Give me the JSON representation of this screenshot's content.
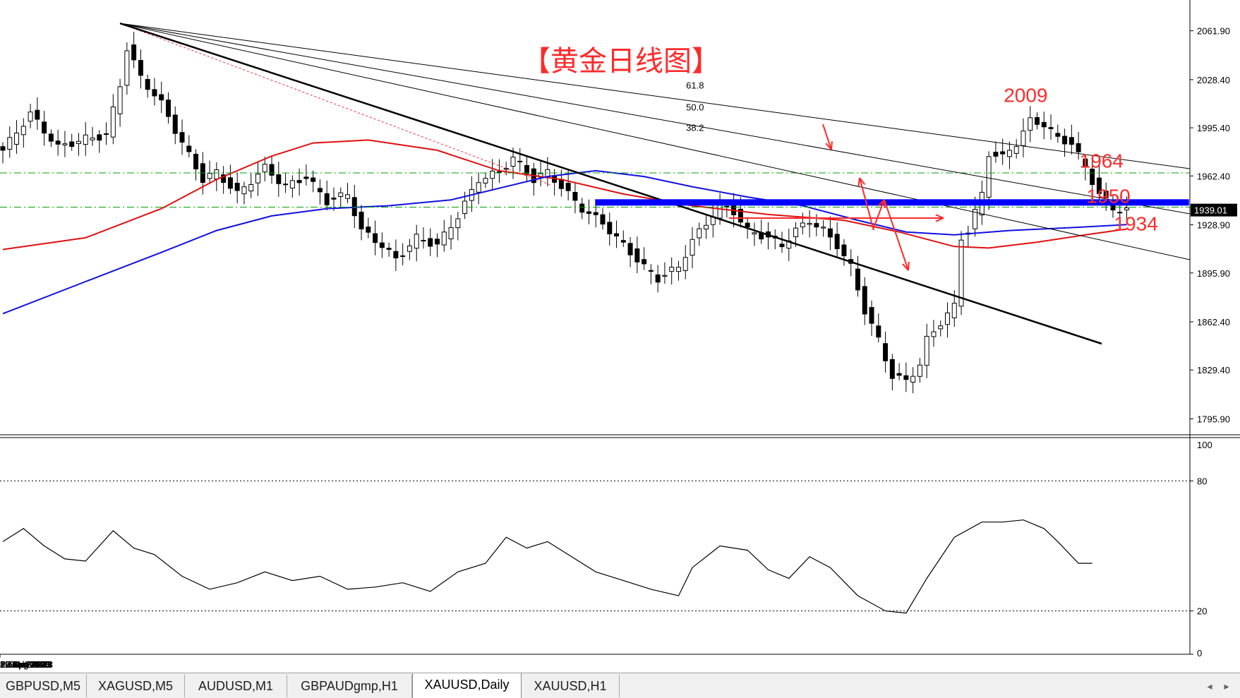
{
  "colors": {
    "background": "#ffffff",
    "candle": "#000000",
    "ma_fast": "#e01010",
    "ma_slow": "#1010e0",
    "annotation": "#ff2a2a",
    "support_band": "#0000ff",
    "ref_line": "#00a000"
  },
  "chart_data": [
    {
      "type": "candlestick",
      "symbol": "XAUUSD",
      "timeframe": "Daily",
      "title": "【黄金日线图】",
      "x_labels": [
        {
          "index": 0,
          "label": "23"
        },
        {
          "index": 15,
          "label": "20 Apr 2023"
        },
        {
          "index": 31,
          "label": "12 May 2023"
        },
        {
          "index": 47,
          "label": "5 Jun 2023"
        },
        {
          "index": 63,
          "label": "27 Jun 2023"
        },
        {
          "index": 79,
          "label": "19 Jul 2023"
        },
        {
          "index": 95,
          "label": "10 Aug 2023"
        },
        {
          "index": 111,
          "label": "1 Sep 2023"
        },
        {
          "index": 127,
          "label": "25 Sep 2023"
        },
        {
          "index": 143,
          "label": "17 Oct 2023"
        },
        {
          "index": 159,
          "label": "8 Nov 2023"
        }
      ],
      "y_ticks": [
        "2061.90",
        "2028.40",
        "1995.40",
        "1962.40",
        "1928.90",
        "1895.90",
        "1862.40",
        "1829.40",
        "1795.90"
      ],
      "y_range": [
        1785.0,
        2083.0
      ],
      "current_price": "1939.01",
      "candle_series": [
        {
          "i": 0,
          "close": 1980
        },
        {
          "i": 4,
          "close": 2005
        },
        {
          "i": 8,
          "close": 1982
        },
        {
          "i": 12,
          "close": 1988
        },
        {
          "i": 15,
          "close": 1990
        },
        {
          "i": 17,
          "close": 2025
        },
        {
          "i": 18,
          "close": 2050
        },
        {
          "i": 20,
          "close": 2030
        },
        {
          "i": 23,
          "close": 2012
        },
        {
          "i": 26,
          "close": 1985
        },
        {
          "i": 29,
          "close": 1960
        },
        {
          "i": 31,
          "close": 1965
        },
        {
          "i": 34,
          "close": 1950
        },
        {
          "i": 38,
          "close": 1968
        },
        {
          "i": 41,
          "close": 1955
        },
        {
          "i": 44,
          "close": 1962
        },
        {
          "i": 47,
          "close": 1945
        },
        {
          "i": 50,
          "close": 1950
        },
        {
          "i": 52,
          "close": 1925
        },
        {
          "i": 55,
          "close": 1915
        },
        {
          "i": 57,
          "close": 1905
        },
        {
          "i": 60,
          "close": 1920
        },
        {
          "i": 63,
          "close": 1915
        },
        {
          "i": 66,
          "close": 1935
        },
        {
          "i": 69,
          "close": 1960
        },
        {
          "i": 72,
          "close": 1965
        },
        {
          "i": 74,
          "close": 1975
        },
        {
          "i": 77,
          "close": 1960
        },
        {
          "i": 79,
          "close": 1965
        },
        {
          "i": 81,
          "close": 1955
        },
        {
          "i": 84,
          "close": 1940
        },
        {
          "i": 87,
          "close": 1930
        },
        {
          "i": 90,
          "close": 1915
        },
        {
          "i": 93,
          "close": 1900
        },
        {
          "i": 95,
          "close": 1892
        },
        {
          "i": 98,
          "close": 1900
        },
        {
          "i": 100,
          "close": 1918
        },
        {
          "i": 102,
          "close": 1930
        },
        {
          "i": 104,
          "close": 1942
        },
        {
          "i": 106,
          "close": 1938
        },
        {
          "i": 108,
          "close": 1925
        },
        {
          "i": 111,
          "close": 1920
        },
        {
          "i": 113,
          "close": 1915
        },
        {
          "i": 115,
          "close": 1925
        },
        {
          "i": 117,
          "close": 1932
        },
        {
          "i": 119,
          "close": 1925
        },
        {
          "i": 121,
          "close": 1915
        },
        {
          "i": 123,
          "close": 1900
        },
        {
          "i": 125,
          "close": 1870
        },
        {
          "i": 127,
          "close": 1850
        },
        {
          "i": 129,
          "close": 1825
        },
        {
          "i": 131,
          "close": 1822
        },
        {
          "i": 133,
          "close": 1833
        },
        {
          "i": 134,
          "close": 1850
        },
        {
          "i": 136,
          "close": 1862
        },
        {
          "i": 138,
          "close": 1873
        },
        {
          "i": 139,
          "close": 1920
        },
        {
          "i": 140,
          "close": 1925
        },
        {
          "i": 142,
          "close": 1950
        },
        {
          "i": 143,
          "close": 1978
        },
        {
          "i": 145,
          "close": 1975
        },
        {
          "i": 147,
          "close": 1985
        },
        {
          "i": 149,
          "close": 2000
        },
        {
          "i": 151,
          "close": 1998
        },
        {
          "i": 153,
          "close": 1988
        },
        {
          "i": 155,
          "close": 1985
        },
        {
          "i": 157,
          "close": 1968
        },
        {
          "i": 159,
          "close": 1950
        },
        {
          "i": 161,
          "close": 1940
        },
        {
          "i": 163,
          "close": 1939
        }
      ],
      "ma_fast": [
        {
          "i": 0,
          "v": 1912
        },
        {
          "i": 12,
          "v": 1920
        },
        {
          "i": 23,
          "v": 1940
        },
        {
          "i": 31,
          "v": 1960
        },
        {
          "i": 39,
          "v": 1976
        },
        {
          "i": 45,
          "v": 1985
        },
        {
          "i": 53,
          "v": 1987
        },
        {
          "i": 63,
          "v": 1980
        },
        {
          "i": 72,
          "v": 1966
        },
        {
          "i": 81,
          "v": 1960
        },
        {
          "i": 90,
          "v": 1950
        },
        {
          "i": 100,
          "v": 1942
        },
        {
          "i": 111,
          "v": 1936
        },
        {
          "i": 122,
          "v": 1932
        },
        {
          "i": 130,
          "v": 1924
        },
        {
          "i": 138,
          "v": 1914
        },
        {
          "i": 143,
          "v": 1913
        },
        {
          "i": 150,
          "v": 1917
        },
        {
          "i": 157,
          "v": 1922
        },
        {
          "i": 163,
          "v": 1926
        }
      ],
      "ma_slow": [
        {
          "i": 0,
          "v": 1868
        },
        {
          "i": 12,
          "v": 1890
        },
        {
          "i": 23,
          "v": 1910
        },
        {
          "i": 31,
          "v": 1925
        },
        {
          "i": 39,
          "v": 1935
        },
        {
          "i": 47,
          "v": 1940
        },
        {
          "i": 56,
          "v": 1942
        },
        {
          "i": 65,
          "v": 1946
        },
        {
          "i": 72,
          "v": 1954
        },
        {
          "i": 79,
          "v": 1962
        },
        {
          "i": 86,
          "v": 1966
        },
        {
          "i": 93,
          "v": 1962
        },
        {
          "i": 100,
          "v": 1955
        },
        {
          "i": 108,
          "v": 1948
        },
        {
          "i": 116,
          "v": 1942
        },
        {
          "i": 124,
          "v": 1932
        },
        {
          "i": 131,
          "v": 1924
        },
        {
          "i": 138,
          "v": 1922
        },
        {
          "i": 146,
          "v": 1925
        },
        {
          "i": 155,
          "v": 1927
        },
        {
          "i": 163,
          "v": 1929
        }
      ],
      "fib_fan": {
        "origin": {
          "i": 17,
          "v": 2067
        },
        "labels": [
          {
            "text": "61.8",
            "i": 95,
            "v": 2029
          },
          {
            "text": "50.0",
            "i": 95,
            "v": 2014
          },
          {
            "text": "38.2",
            "i": 95,
            "v": 2000
          }
        ]
      },
      "annotations": [
        {
          "text": "2009",
          "i": 147,
          "v": 2013
        },
        {
          "text": "1964",
          "i": 158,
          "v": 1968
        },
        {
          "text": "1950",
          "i": 159,
          "v": 1944
        },
        {
          "text": "1934",
          "i": 163,
          "v": 1925
        }
      ],
      "support_band": {
        "from_i": 90,
        "to_i": 171,
        "v": 1944
      },
      "ref_lines": [
        1964.5,
        1941
      ]
    },
    {
      "type": "line",
      "series_label": "",
      "y_ticks": [
        "100",
        "80",
        "20",
        "0"
      ],
      "y_range": [
        0,
        100
      ],
      "levels": [
        80,
        20
      ],
      "values": [
        {
          "i": 0,
          "v": 52
        },
        {
          "i": 3,
          "v": 58
        },
        {
          "i": 6,
          "v": 50
        },
        {
          "i": 9,
          "v": 44
        },
        {
          "i": 12,
          "v": 43
        },
        {
          "i": 16,
          "v": 57
        },
        {
          "i": 19,
          "v": 49
        },
        {
          "i": 22,
          "v": 46
        },
        {
          "i": 26,
          "v": 36
        },
        {
          "i": 30,
          "v": 30
        },
        {
          "i": 34,
          "v": 33
        },
        {
          "i": 38,
          "v": 38
        },
        {
          "i": 42,
          "v": 34
        },
        {
          "i": 46,
          "v": 36
        },
        {
          "i": 50,
          "v": 30
        },
        {
          "i": 54,
          "v": 31
        },
        {
          "i": 58,
          "v": 33
        },
        {
          "i": 62,
          "v": 29
        },
        {
          "i": 66,
          "v": 38
        },
        {
          "i": 70,
          "v": 42
        },
        {
          "i": 73,
          "v": 54
        },
        {
          "i": 76,
          "v": 49
        },
        {
          "i": 79,
          "v": 52
        },
        {
          "i": 82,
          "v": 46
        },
        {
          "i": 86,
          "v": 38
        },
        {
          "i": 90,
          "v": 34
        },
        {
          "i": 94,
          "v": 30
        },
        {
          "i": 98,
          "v": 27
        },
        {
          "i": 100,
          "v": 40
        },
        {
          "i": 104,
          "v": 50
        },
        {
          "i": 108,
          "v": 48
        },
        {
          "i": 111,
          "v": 39
        },
        {
          "i": 114,
          "v": 35
        },
        {
          "i": 117,
          "v": 45
        },
        {
          "i": 120,
          "v": 40
        },
        {
          "i": 124,
          "v": 27
        },
        {
          "i": 128,
          "v": 20
        },
        {
          "i": 131,
          "v": 19
        },
        {
          "i": 134,
          "v": 35
        },
        {
          "i": 138,
          "v": 54
        },
        {
          "i": 142,
          "v": 61
        },
        {
          "i": 145,
          "v": 61
        },
        {
          "i": 148,
          "v": 62
        },
        {
          "i": 151,
          "v": 58
        },
        {
          "i": 153,
          "v": 52
        },
        {
          "i": 156,
          "v": 42
        },
        {
          "i": 158,
          "v": 42
        }
      ]
    }
  ],
  "tabs": [
    {
      "label": "GBPUSD,M5",
      "active": false
    },
    {
      "label": "XAGUSD,M5",
      "active": false
    },
    {
      "label": "AUDUSD,M1",
      "active": false
    },
    {
      "label": "GBPAUDgmp,H1",
      "active": false
    },
    {
      "label": "XAUUSD,Daily",
      "active": true
    },
    {
      "label": "XAUUSD,H1",
      "active": false
    }
  ],
  "tab_scroll": {
    "left": "◂",
    "right": "▸"
  }
}
